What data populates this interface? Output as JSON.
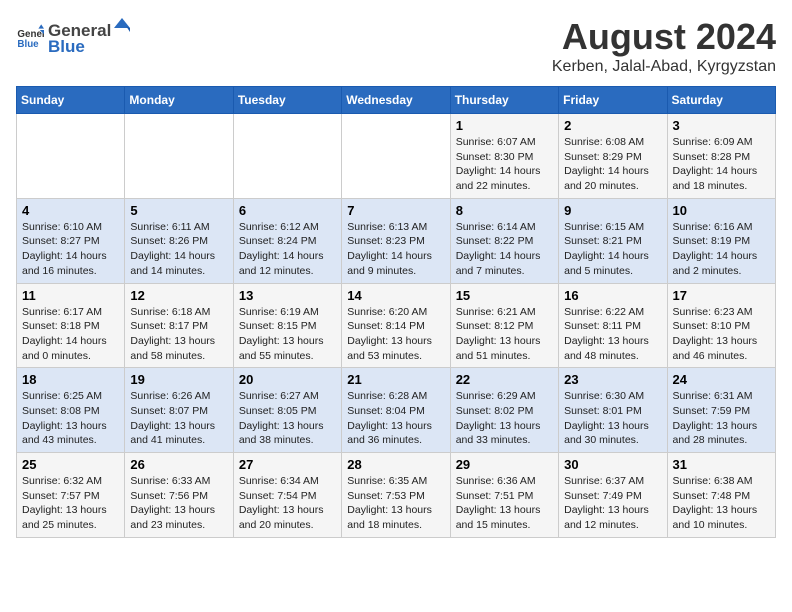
{
  "logo": {
    "general": "General",
    "blue": "Blue"
  },
  "title": "August 2024",
  "subtitle": "Kerben, Jalal-Abad, Kyrgyzstan",
  "days_of_week": [
    "Sunday",
    "Monday",
    "Tuesday",
    "Wednesday",
    "Thursday",
    "Friday",
    "Saturday"
  ],
  "weeks": [
    [
      {
        "day": "",
        "info": ""
      },
      {
        "day": "",
        "info": ""
      },
      {
        "day": "",
        "info": ""
      },
      {
        "day": "",
        "info": ""
      },
      {
        "day": "1",
        "info": "Sunrise: 6:07 AM\nSunset: 8:30 PM\nDaylight: 14 hours and 22 minutes."
      },
      {
        "day": "2",
        "info": "Sunrise: 6:08 AM\nSunset: 8:29 PM\nDaylight: 14 hours and 20 minutes."
      },
      {
        "day": "3",
        "info": "Sunrise: 6:09 AM\nSunset: 8:28 PM\nDaylight: 14 hours and 18 minutes."
      }
    ],
    [
      {
        "day": "4",
        "info": "Sunrise: 6:10 AM\nSunset: 8:27 PM\nDaylight: 14 hours and 16 minutes."
      },
      {
        "day": "5",
        "info": "Sunrise: 6:11 AM\nSunset: 8:26 PM\nDaylight: 14 hours and 14 minutes."
      },
      {
        "day": "6",
        "info": "Sunrise: 6:12 AM\nSunset: 8:24 PM\nDaylight: 14 hours and 12 minutes."
      },
      {
        "day": "7",
        "info": "Sunrise: 6:13 AM\nSunset: 8:23 PM\nDaylight: 14 hours and 9 minutes."
      },
      {
        "day": "8",
        "info": "Sunrise: 6:14 AM\nSunset: 8:22 PM\nDaylight: 14 hours and 7 minutes."
      },
      {
        "day": "9",
        "info": "Sunrise: 6:15 AM\nSunset: 8:21 PM\nDaylight: 14 hours and 5 minutes."
      },
      {
        "day": "10",
        "info": "Sunrise: 6:16 AM\nSunset: 8:19 PM\nDaylight: 14 hours and 2 minutes."
      }
    ],
    [
      {
        "day": "11",
        "info": "Sunrise: 6:17 AM\nSunset: 8:18 PM\nDaylight: 14 hours and 0 minutes."
      },
      {
        "day": "12",
        "info": "Sunrise: 6:18 AM\nSunset: 8:17 PM\nDaylight: 13 hours and 58 minutes."
      },
      {
        "day": "13",
        "info": "Sunrise: 6:19 AM\nSunset: 8:15 PM\nDaylight: 13 hours and 55 minutes."
      },
      {
        "day": "14",
        "info": "Sunrise: 6:20 AM\nSunset: 8:14 PM\nDaylight: 13 hours and 53 minutes."
      },
      {
        "day": "15",
        "info": "Sunrise: 6:21 AM\nSunset: 8:12 PM\nDaylight: 13 hours and 51 minutes."
      },
      {
        "day": "16",
        "info": "Sunrise: 6:22 AM\nSunset: 8:11 PM\nDaylight: 13 hours and 48 minutes."
      },
      {
        "day": "17",
        "info": "Sunrise: 6:23 AM\nSunset: 8:10 PM\nDaylight: 13 hours and 46 minutes."
      }
    ],
    [
      {
        "day": "18",
        "info": "Sunrise: 6:25 AM\nSunset: 8:08 PM\nDaylight: 13 hours and 43 minutes."
      },
      {
        "day": "19",
        "info": "Sunrise: 6:26 AM\nSunset: 8:07 PM\nDaylight: 13 hours and 41 minutes."
      },
      {
        "day": "20",
        "info": "Sunrise: 6:27 AM\nSunset: 8:05 PM\nDaylight: 13 hours and 38 minutes."
      },
      {
        "day": "21",
        "info": "Sunrise: 6:28 AM\nSunset: 8:04 PM\nDaylight: 13 hours and 36 minutes."
      },
      {
        "day": "22",
        "info": "Sunrise: 6:29 AM\nSunset: 8:02 PM\nDaylight: 13 hours and 33 minutes."
      },
      {
        "day": "23",
        "info": "Sunrise: 6:30 AM\nSunset: 8:01 PM\nDaylight: 13 hours and 30 minutes."
      },
      {
        "day": "24",
        "info": "Sunrise: 6:31 AM\nSunset: 7:59 PM\nDaylight: 13 hours and 28 minutes."
      }
    ],
    [
      {
        "day": "25",
        "info": "Sunrise: 6:32 AM\nSunset: 7:57 PM\nDaylight: 13 hours and 25 minutes."
      },
      {
        "day": "26",
        "info": "Sunrise: 6:33 AM\nSunset: 7:56 PM\nDaylight: 13 hours and 23 minutes."
      },
      {
        "day": "27",
        "info": "Sunrise: 6:34 AM\nSunset: 7:54 PM\nDaylight: 13 hours and 20 minutes."
      },
      {
        "day": "28",
        "info": "Sunrise: 6:35 AM\nSunset: 7:53 PM\nDaylight: 13 hours and 18 minutes."
      },
      {
        "day": "29",
        "info": "Sunrise: 6:36 AM\nSunset: 7:51 PM\nDaylight: 13 hours and 15 minutes."
      },
      {
        "day": "30",
        "info": "Sunrise: 6:37 AM\nSunset: 7:49 PM\nDaylight: 13 hours and 12 minutes."
      },
      {
        "day": "31",
        "info": "Sunrise: 6:38 AM\nSunset: 7:48 PM\nDaylight: 13 hours and 10 minutes."
      }
    ]
  ]
}
